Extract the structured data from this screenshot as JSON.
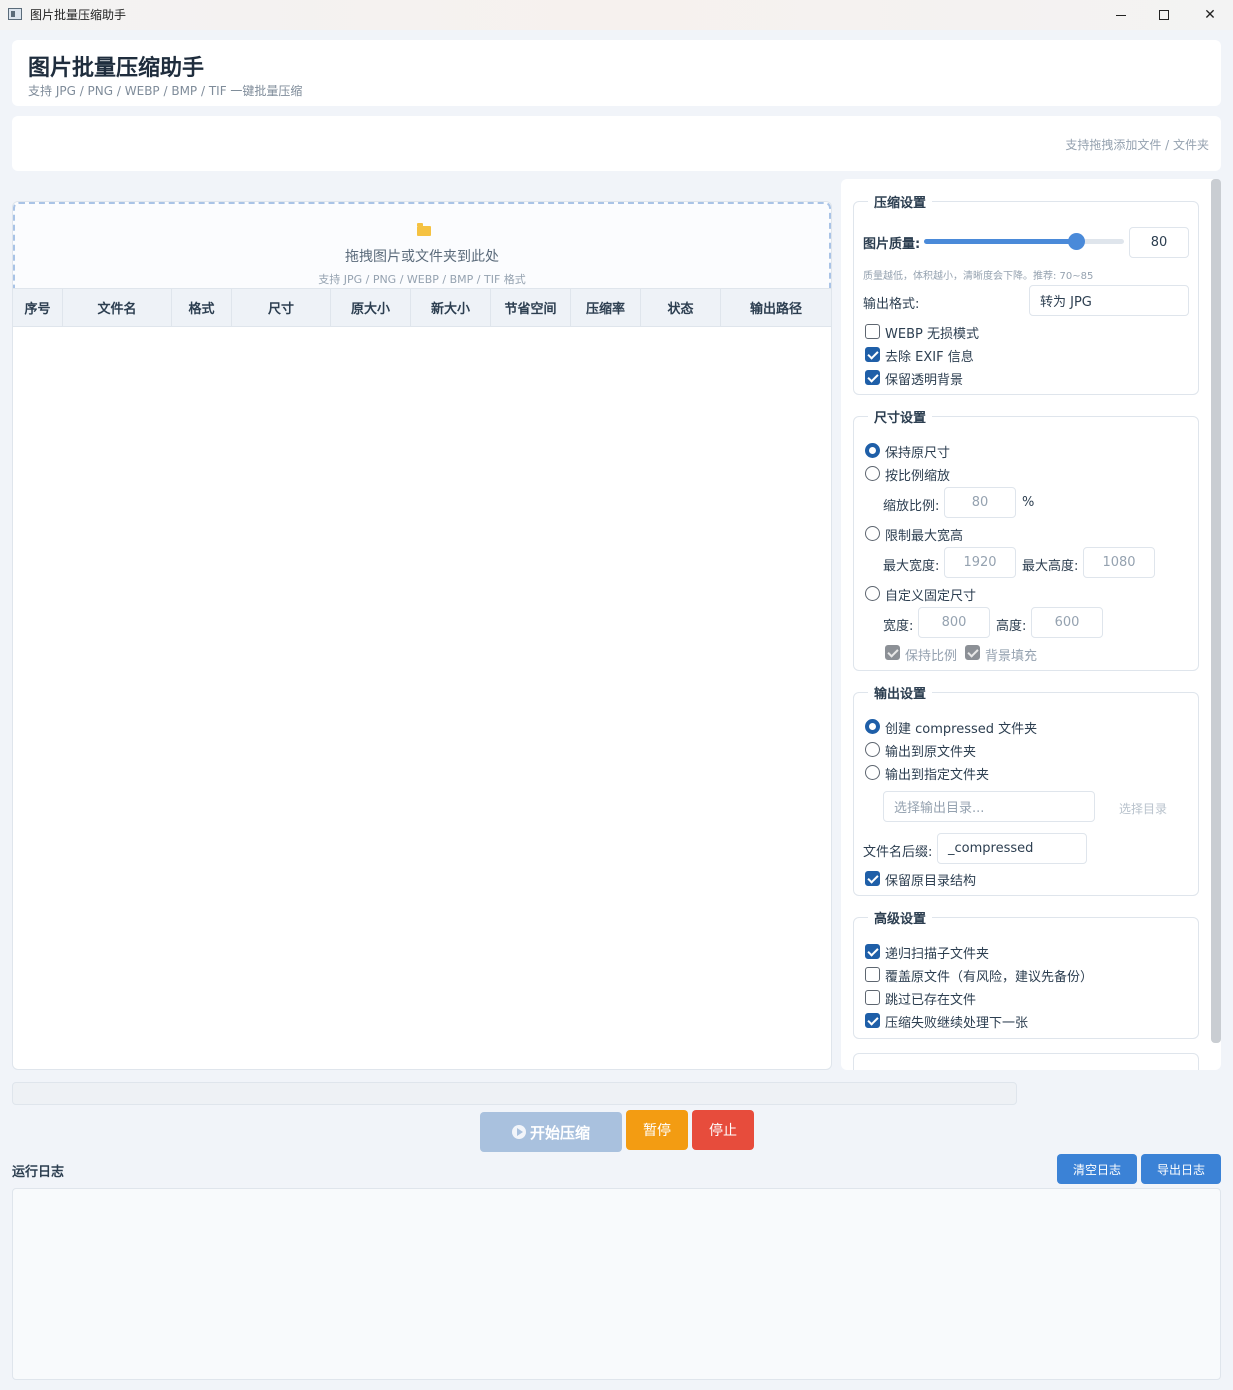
{
  "window": {
    "title": "图片批量压缩助手"
  },
  "header": {
    "title": "图片批量压缩助手",
    "subtitle": "支持 JPG / PNG / WEBP / BMP / TIF 一键批量压缩"
  },
  "toolbar": {
    "hint": "支持拖拽添加文件 / 文件夹"
  },
  "drop_zone": {
    "icon": "folder-icon",
    "main": "拖拽图片或文件夹到此处",
    "sub": "支持 JPG / PNG / WEBP / BMP / TIF 格式"
  },
  "table": {
    "columns": [
      "序号",
      "文件名",
      "格式",
      "尺寸",
      "原大小",
      "新大小",
      "节省空间",
      "压缩率",
      "状态",
      "输出路径"
    ],
    "rows": []
  },
  "compress_settings": {
    "title": "压缩设置",
    "quality_label": "图片质量:",
    "quality_value": "80",
    "quality_level": 0.8,
    "quality_note": "质量越低，体积越小，清晰度会下降。推荐: 70~85",
    "format_label": "输出格式:",
    "format_value": "转为 JPG",
    "webp_lossless": {
      "label": "WEBP 无损模式",
      "checked": false
    },
    "strip_exif": {
      "label": "去除 EXIF 信息",
      "checked": true
    },
    "keep_alpha": {
      "label": "保留透明背景",
      "checked": true
    }
  },
  "size_settings": {
    "title": "尺寸设置",
    "keep_original": {
      "label": "保持原尺寸",
      "checked": true
    },
    "scale": {
      "label": "按比例缩放",
      "checked": false
    },
    "scale_label": "缩放比例:",
    "scale_value": "80",
    "scale_unit": "%",
    "limit": {
      "label": "限制最大宽高",
      "checked": false
    },
    "max_w_label": "最大宽度:",
    "max_w_value": "1920",
    "max_h_label": "最大高度:",
    "max_h_value": "1080",
    "custom": {
      "label": "自定义固定尺寸",
      "checked": false
    },
    "w_label": "宽度:",
    "w_value": "800",
    "h_label": "高度:",
    "h_value": "600",
    "keep_ratio": {
      "label": "保持比例",
      "checked": true
    },
    "bg_fill": {
      "label": "背景填充",
      "checked": true
    }
  },
  "output_settings": {
    "title": "输出设置",
    "create_folder": {
      "label": "创建 compressed 文件夹",
      "checked": true
    },
    "to_original": {
      "label": "输出到原文件夹",
      "checked": false
    },
    "to_custom": {
      "label": "输出到指定文件夹",
      "checked": false
    },
    "dir_placeholder": "选择输出目录...",
    "choose_dir": "选择目录",
    "suffix_label": "文件名后缀:",
    "suffix_value": "_compressed",
    "keep_structure": {
      "label": "保留原目录结构",
      "checked": true
    }
  },
  "advanced_settings": {
    "title": "高级设置",
    "recursive": {
      "label": "递归扫描子文件夹",
      "checked": true
    },
    "overwrite": {
      "label": "覆盖原文件（有风险，建议先备份）",
      "checked": false
    },
    "skip_existing": {
      "label": "跳过已存在文件",
      "checked": false
    },
    "continue_on_error": {
      "label": "压缩失败继续处理下一张",
      "checked": true
    }
  },
  "progress": {
    "value": 0
  },
  "actions": {
    "start": "开始压缩",
    "pause": "暂停",
    "stop": "停止"
  },
  "log": {
    "title": "运行日志",
    "clear": "清空日志",
    "export": "导出日志",
    "content": ""
  },
  "colors": {
    "accent": "#3b82d6",
    "pause": "#f39c12",
    "stop": "#e74c3c",
    "start_disabled": "#a9c1de"
  }
}
